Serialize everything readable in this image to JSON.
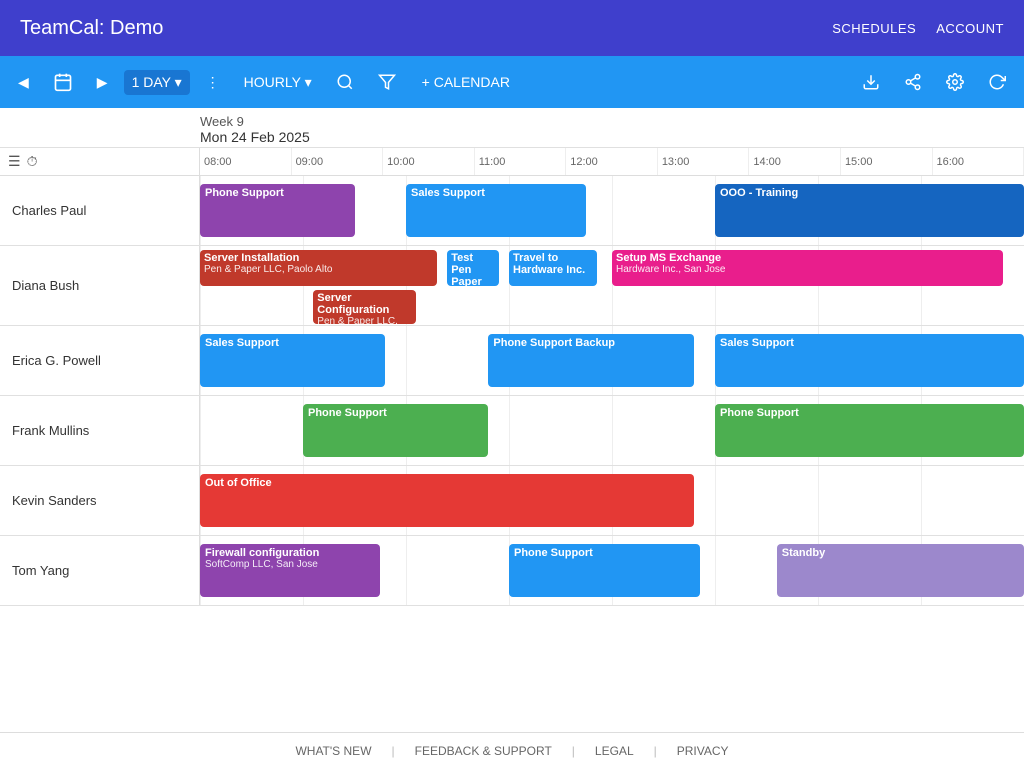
{
  "app": {
    "title": "TeamCal:  Demo",
    "nav": [
      "SCHEDULES",
      "ACCOUNT"
    ]
  },
  "toolbar": {
    "prev_label": "◀",
    "next_label": "▶",
    "today_label": "📅",
    "day_view": "1 DAY ▾",
    "hourly_view": "HOURLY ▾",
    "more_label": "⋮",
    "search_label": "🔍",
    "filter_label": "⛛",
    "add_calendar": "+ CALENDAR",
    "download_label": "⬇",
    "share_label": "⟨⟩",
    "settings_label": "⚙",
    "refresh_label": "↻"
  },
  "calendar": {
    "week": "Week 9",
    "date": "Mon 24 Feb 2025",
    "times": [
      "08:00",
      "09:00",
      "10:00",
      "11:00",
      "12:00",
      "13:00",
      "14:00",
      "15:00",
      "16:00"
    ]
  },
  "resources": [
    {
      "name": "Charles Paul",
      "events": [
        {
          "title": "Phone Support",
          "start": 0,
          "end": 1.5,
          "color": "purple"
        },
        {
          "title": "Sales Support",
          "start": 2,
          "end": 3.75,
          "color": "blue"
        },
        {
          "title": "OOO - Training",
          "start": 5,
          "end": 8,
          "color": "blue2"
        }
      ]
    },
    {
      "name": "Diana Bush",
      "events": [
        {
          "title": "Server Installation",
          "sub": "Pen & Paper LLC, Paolo Alto",
          "start": 0,
          "end": 2.3,
          "color": "crimson",
          "multiline": true
        },
        {
          "title": "Test Pen Paper",
          "start": 2.4,
          "end": 2.9,
          "color": "blue",
          "multiline": true
        },
        {
          "title": "Travel to Hardware Inc.",
          "start": 3,
          "end": 3.85,
          "color": "blue",
          "multiline": true
        },
        {
          "title": "Setup MS Exchange",
          "sub": "Hardware Inc., San Jose",
          "start": 4,
          "end": 7.8,
          "color": "pink",
          "multiline": true
        },
        {
          "title": "Server Configuration",
          "sub": "Pen & Paper LLC, Paolo Alto",
          "start": 1.1,
          "end": 2.1,
          "color": "crimson",
          "multiline": true,
          "row2": true
        }
      ]
    },
    {
      "name": "Erica G. Powell",
      "events": [
        {
          "title": "Sales Support",
          "start": 0,
          "end": 1.8,
          "color": "blue"
        },
        {
          "title": "Phone Support Backup",
          "start": 2.8,
          "end": 4.8,
          "color": "blue"
        },
        {
          "title": "Sales Support",
          "start": 5,
          "end": 8,
          "color": "blue"
        }
      ]
    },
    {
      "name": "Frank Mullins",
      "events": [
        {
          "title": "Phone Support",
          "start": 1,
          "end": 2.8,
          "color": "green"
        },
        {
          "title": "Phone Support",
          "start": 5,
          "end": 8,
          "color": "green"
        }
      ]
    },
    {
      "name": "Kevin Sanders",
      "events": [
        {
          "title": "Out of Office",
          "start": 0,
          "end": 4.8,
          "color": "red"
        }
      ]
    },
    {
      "name": "Tom Yang",
      "events": [
        {
          "title": "Firewall configuration",
          "sub": "SoftComp LLC, San Jose",
          "start": 0,
          "end": 1.75,
          "color": "purple",
          "multiline": true
        },
        {
          "title": "Phone Support",
          "start": 3,
          "end": 4.85,
          "color": "blue"
        },
        {
          "title": "Standby",
          "start": 5.6,
          "end": 8,
          "color": "lavender"
        }
      ]
    }
  ],
  "footer": {
    "items": [
      "WHAT'S NEW",
      "FEEDBACK & SUPPORT",
      "LEGAL",
      "PRIVACY"
    ]
  }
}
